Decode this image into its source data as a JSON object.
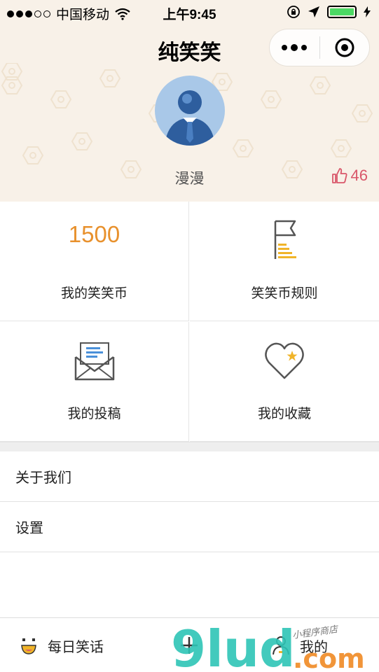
{
  "status_bar": {
    "carrier": "中国移动",
    "time": "上午9:45"
  },
  "app": {
    "title": "纯笑笑"
  },
  "profile": {
    "username": "漫漫",
    "likes": "46"
  },
  "grid": {
    "coins_value": "1500",
    "coins_label": "我的笑笑币",
    "rules_label": "笑笑币规则",
    "submissions_label": "我的投稿",
    "favorites_label": "我的收藏"
  },
  "list": {
    "items": [
      "关于我们",
      "设置"
    ]
  },
  "tabbar": {
    "tab1": "每日笑话",
    "tab3": "我的"
  },
  "watermark": {
    "brand": "9lud",
    "domain": ".com",
    "script": "小程序商店"
  },
  "colors": {
    "header_bg": "#f8f1e8",
    "coins": "#e8912d",
    "likes": "#d9576a",
    "battery": "#4cd964",
    "watermark_teal": "#2ec4b6",
    "watermark_orange": "#f08a24"
  },
  "icons": {
    "wifi": "wifi-icon",
    "lock": "orientation-lock-icon",
    "location": "location-arrow-icon",
    "thumb": "thumbs-up-icon",
    "rules": "flag-coins-icon",
    "submissions": "envelope-icon",
    "favorites": "heart-star-icon",
    "tab1": "smiley-icon",
    "tab2": "plus-icon",
    "tab3": "person-icon"
  }
}
